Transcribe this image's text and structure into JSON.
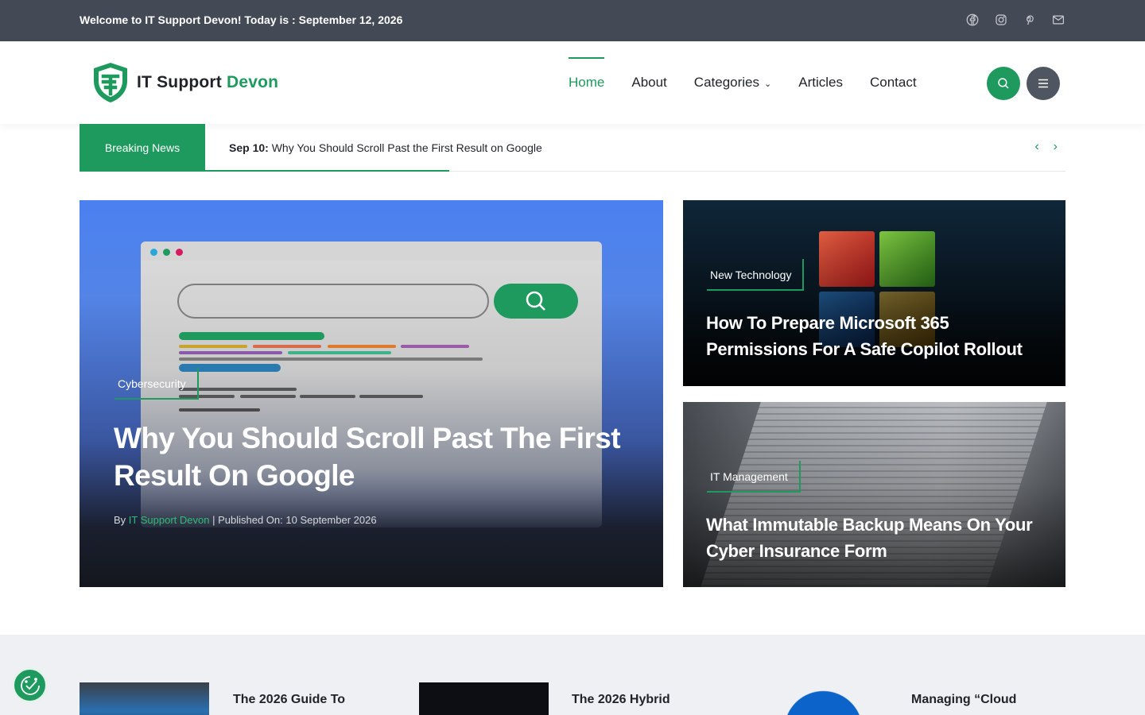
{
  "topbar": {
    "welcome": "Welcome to IT Support Devon! Today is : September 12, 2026",
    "socials": [
      "facebook-icon",
      "instagram-icon",
      "pinterest-icon",
      "mail-icon"
    ]
  },
  "brand": {
    "name_a": "IT Support",
    "name_b": "Devon"
  },
  "nav": {
    "items": [
      {
        "label": "Home",
        "active": true
      },
      {
        "label": "About"
      },
      {
        "label": "Categories",
        "dropdown": true
      },
      {
        "label": "Articles"
      },
      {
        "label": "Contact"
      }
    ],
    "search_icon": "search-icon",
    "menu_icon": "menu-icon"
  },
  "breaking": {
    "badge": "Breaking News",
    "date": "Sep 10:",
    "headline": "Why You Should Scroll Past the First Result on Google",
    "prev": "‹",
    "next": "›"
  },
  "featured": {
    "category": "Cybersecurity",
    "title": "Why You Should Scroll Past The First Result On Google",
    "by": "By",
    "author": "IT Support Devon",
    "published": "Published On: 10 September 2026"
  },
  "side_posts": [
    {
      "category": "New Technology",
      "title": "How To Prepare Microsoft 365 Permissions For A Safe Copilot Rollout"
    },
    {
      "category": "IT Management",
      "title": "What Immutable Backup Means On Your Cyber Insurance Form"
    }
  ],
  "latest": [
    {
      "title": "The 2026 Guide To"
    },
    {
      "title": "The 2026 Hybrid"
    },
    {
      "title": "Managing “Cloud"
    }
  ],
  "colors": {
    "accent": "#1e9a5e",
    "topbar": "#434a56"
  }
}
